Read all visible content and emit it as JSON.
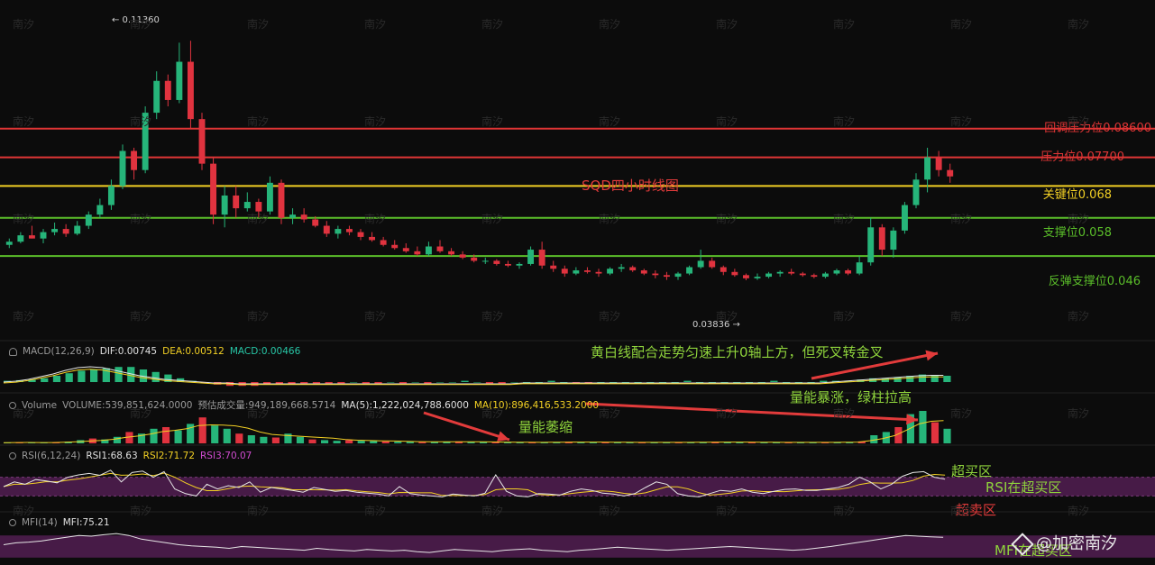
{
  "chart_data": {
    "type": "candlestick",
    "title": "SQD四小时线图",
    "price_range": [
      0.02,
      0.123
    ],
    "peak_label": "← 0.11360",
    "low_label": "0.03836 →",
    "levels": [
      {
        "label": "回调压力位0.08600",
        "value": 0.086,
        "color": "#e03535"
      },
      {
        "label": "压力位0.07700",
        "value": 0.077,
        "color": "#e03535"
      },
      {
        "label": "关键位0.068",
        "value": 0.068,
        "color": "#f2d024"
      },
      {
        "label": "支撑位0.058",
        "value": 0.058,
        "color": "#5bbf2a"
      },
      {
        "label": "反弹支撑位0.046",
        "value": 0.046,
        "color": "#5bbf2a"
      }
    ],
    "candles": [
      {
        "o": 0.0495,
        "h": 0.0515,
        "l": 0.0485,
        "c": 0.0505
      },
      {
        "o": 0.0505,
        "h": 0.0535,
        "l": 0.05,
        "c": 0.0525
      },
      {
        "o": 0.0525,
        "h": 0.0555,
        "l": 0.0515,
        "c": 0.0515
      },
      {
        "o": 0.0515,
        "h": 0.0545,
        "l": 0.05,
        "c": 0.0535
      },
      {
        "o": 0.0535,
        "h": 0.0565,
        "l": 0.0525,
        "c": 0.0545
      },
      {
        "o": 0.0545,
        "h": 0.056,
        "l": 0.052,
        "c": 0.053
      },
      {
        "o": 0.053,
        "h": 0.057,
        "l": 0.0525,
        "c": 0.0555
      },
      {
        "o": 0.0555,
        "h": 0.06,
        "l": 0.0545,
        "c": 0.059
      },
      {
        "o": 0.059,
        "h": 0.064,
        "l": 0.058,
        "c": 0.062
      },
      {
        "o": 0.062,
        "h": 0.07,
        "l": 0.0605,
        "c": 0.068
      },
      {
        "o": 0.068,
        "h": 0.081,
        "l": 0.067,
        "c": 0.079
      },
      {
        "o": 0.079,
        "h": 0.08,
        "l": 0.07,
        "c": 0.073
      },
      {
        "o": 0.073,
        "h": 0.093,
        "l": 0.072,
        "c": 0.091
      },
      {
        "o": 0.091,
        "h": 0.104,
        "l": 0.089,
        "c": 0.101
      },
      {
        "o": 0.101,
        "h": 0.103,
        "l": 0.093,
        "c": 0.095
      },
      {
        "o": 0.095,
        "h": 0.113,
        "l": 0.094,
        "c": 0.107
      },
      {
        "o": 0.107,
        "h": 0.1136,
        "l": 0.086,
        "c": 0.089
      },
      {
        "o": 0.089,
        "h": 0.091,
        "l": 0.073,
        "c": 0.075
      },
      {
        "o": 0.075,
        "h": 0.077,
        "l": 0.056,
        "c": 0.059
      },
      {
        "o": 0.059,
        "h": 0.068,
        "l": 0.055,
        "c": 0.065
      },
      {
        "o": 0.065,
        "h": 0.068,
        "l": 0.058,
        "c": 0.061
      },
      {
        "o": 0.061,
        "h": 0.066,
        "l": 0.06,
        "c": 0.063
      },
      {
        "o": 0.063,
        "h": 0.064,
        "l": 0.058,
        "c": 0.06
      },
      {
        "o": 0.06,
        "h": 0.071,
        "l": 0.059,
        "c": 0.069
      },
      {
        "o": 0.069,
        "h": 0.07,
        "l": 0.056,
        "c": 0.058
      },
      {
        "o": 0.058,
        "h": 0.061,
        "l": 0.056,
        "c": 0.059
      },
      {
        "o": 0.059,
        "h": 0.061,
        "l": 0.0565,
        "c": 0.0575
      },
      {
        "o": 0.0575,
        "h": 0.0585,
        "l": 0.055,
        "c": 0.0555
      },
      {
        "o": 0.0555,
        "h": 0.057,
        "l": 0.052,
        "c": 0.053
      },
      {
        "o": 0.053,
        "h": 0.0555,
        "l": 0.0515,
        "c": 0.0545
      },
      {
        "o": 0.0545,
        "h": 0.0555,
        "l": 0.0525,
        "c": 0.0535
      },
      {
        "o": 0.0535,
        "h": 0.0545,
        "l": 0.051,
        "c": 0.052
      },
      {
        "o": 0.052,
        "h": 0.0535,
        "l": 0.0505,
        "c": 0.051
      },
      {
        "o": 0.051,
        "h": 0.052,
        "l": 0.049,
        "c": 0.0495
      },
      {
        "o": 0.0495,
        "h": 0.051,
        "l": 0.048,
        "c": 0.0485
      },
      {
        "o": 0.0485,
        "h": 0.05,
        "l": 0.047,
        "c": 0.0475
      },
      {
        "o": 0.0475,
        "h": 0.049,
        "l": 0.046,
        "c": 0.0465
      },
      {
        "o": 0.0465,
        "h": 0.0505,
        "l": 0.046,
        "c": 0.049
      },
      {
        "o": 0.049,
        "h": 0.051,
        "l": 0.047,
        "c": 0.0475
      },
      {
        "o": 0.0475,
        "h": 0.0485,
        "l": 0.046,
        "c": 0.0465
      },
      {
        "o": 0.0465,
        "h": 0.0475,
        "l": 0.045,
        "c": 0.0455
      },
      {
        "o": 0.0455,
        "h": 0.0465,
        "l": 0.044,
        "c": 0.0445
      },
      {
        "o": 0.0445,
        "h": 0.0455,
        "l": 0.0435,
        "c": 0.0445
      },
      {
        "o": 0.0445,
        "h": 0.045,
        "l": 0.043,
        "c": 0.0435
      },
      {
        "o": 0.0435,
        "h": 0.0445,
        "l": 0.0425,
        "c": 0.043
      },
      {
        "o": 0.043,
        "h": 0.044,
        "l": 0.042,
        "c": 0.0435
      },
      {
        "o": 0.0435,
        "h": 0.049,
        "l": 0.043,
        "c": 0.048
      },
      {
        "o": 0.048,
        "h": 0.0505,
        "l": 0.042,
        "c": 0.043
      },
      {
        "o": 0.043,
        "h": 0.0445,
        "l": 0.041,
        "c": 0.042
      },
      {
        "o": 0.042,
        "h": 0.043,
        "l": 0.0395,
        "c": 0.0405
      },
      {
        "o": 0.0405,
        "h": 0.0425,
        "l": 0.04,
        "c": 0.0415
      },
      {
        "o": 0.0415,
        "h": 0.0425,
        "l": 0.0405,
        "c": 0.041
      },
      {
        "o": 0.041,
        "h": 0.042,
        "l": 0.0395,
        "c": 0.0405
      },
      {
        "o": 0.0405,
        "h": 0.0425,
        "l": 0.04,
        "c": 0.042
      },
      {
        "o": 0.042,
        "h": 0.0435,
        "l": 0.041,
        "c": 0.0425
      },
      {
        "o": 0.0425,
        "h": 0.043,
        "l": 0.041,
        "c": 0.0415
      },
      {
        "o": 0.0415,
        "h": 0.042,
        "l": 0.04,
        "c": 0.0405
      },
      {
        "o": 0.0405,
        "h": 0.0415,
        "l": 0.039,
        "c": 0.04
      },
      {
        "o": 0.04,
        "h": 0.041,
        "l": 0.0385,
        "c": 0.0395
      },
      {
        "o": 0.0395,
        "h": 0.041,
        "l": 0.0385,
        "c": 0.0405
      },
      {
        "o": 0.0405,
        "h": 0.043,
        "l": 0.04,
        "c": 0.0425
      },
      {
        "o": 0.0425,
        "h": 0.048,
        "l": 0.042,
        "c": 0.0445
      },
      {
        "o": 0.0445,
        "h": 0.0455,
        "l": 0.042,
        "c": 0.0425
      },
      {
        "o": 0.0425,
        "h": 0.043,
        "l": 0.04,
        "c": 0.041
      },
      {
        "o": 0.041,
        "h": 0.042,
        "l": 0.0395,
        "c": 0.04
      },
      {
        "o": 0.04,
        "h": 0.0405,
        "l": 0.0384,
        "c": 0.039
      },
      {
        "o": 0.039,
        "h": 0.0405,
        "l": 0.0385,
        "c": 0.0395
      },
      {
        "o": 0.0395,
        "h": 0.041,
        "l": 0.039,
        "c": 0.0405
      },
      {
        "o": 0.0405,
        "h": 0.0415,
        "l": 0.0395,
        "c": 0.041
      },
      {
        "o": 0.041,
        "h": 0.042,
        "l": 0.04,
        "c": 0.0405
      },
      {
        "o": 0.0405,
        "h": 0.041,
        "l": 0.0395,
        "c": 0.04
      },
      {
        "o": 0.04,
        "h": 0.0405,
        "l": 0.039,
        "c": 0.0395
      },
      {
        "o": 0.0395,
        "h": 0.041,
        "l": 0.039,
        "c": 0.0405
      },
      {
        "o": 0.0405,
        "h": 0.042,
        "l": 0.04,
        "c": 0.0415
      },
      {
        "o": 0.0415,
        "h": 0.042,
        "l": 0.04,
        "c": 0.0405
      },
      {
        "o": 0.0405,
        "h": 0.046,
        "l": 0.04,
        "c": 0.044
      },
      {
        "o": 0.044,
        "h": 0.058,
        "l": 0.043,
        "c": 0.055
      },
      {
        "o": 0.055,
        "h": 0.056,
        "l": 0.046,
        "c": 0.048
      },
      {
        "o": 0.048,
        "h": 0.055,
        "l": 0.0455,
        "c": 0.054
      },
      {
        "o": 0.054,
        "h": 0.063,
        "l": 0.053,
        "c": 0.062
      },
      {
        "o": 0.062,
        "h": 0.072,
        "l": 0.061,
        "c": 0.07
      },
      {
        "o": 0.07,
        "h": 0.08,
        "l": 0.066,
        "c": 0.077
      },
      {
        "o": 0.077,
        "h": 0.079,
        "l": 0.071,
        "c": 0.073
      },
      {
        "o": 0.073,
        "h": 0.075,
        "l": 0.069,
        "c": 0.071
      }
    ],
    "macd": {
      "label": "MACD(12,26,9)",
      "dif": "DIF:0.00745",
      "dea": "DEA:0.00512",
      "macd": "MACD:0.00466",
      "hist": [
        0.001,
        0.0015,
        0.002,
        0.003,
        0.005,
        0.007,
        0.009,
        0.01,
        0.011,
        0.012,
        0.012,
        0.01,
        0.008,
        0.006,
        0.003,
        0.001,
        -0.001,
        -0.002,
        -0.003,
        -0.003,
        -0.003,
        -0.002,
        -0.002,
        -0.002,
        -0.001,
        -0.001,
        -0.001,
        -0.001,
        0,
        -0.001,
        -0.001,
        0,
        -0.001,
        0,
        -0.001,
        0,
        0,
        0.001,
        0,
        -0.001,
        -0.001,
        0,
        0,
        0,
        0.001,
        0,
        -0.001,
        -0.001,
        0,
        0,
        0,
        0,
        0,
        0,
        0,
        0.001,
        0,
        0,
        0,
        0,
        0,
        0,
        0.001,
        0,
        0,
        0,
        0.001,
        0.001,
        0.001,
        0.002,
        0.003,
        0.003,
        0.004,
        0.005,
        0.006,
        0.005,
        0.005
      ],
      "dif_line": [
        0.0,
        0.001,
        0.003,
        0.006,
        0.009,
        0.013,
        0.016,
        0.017,
        0.016,
        0.013,
        0.01,
        0.007,
        0.005,
        0.003,
        0.002,
        0.001,
        0.0,
        -0.001,
        -0.001,
        -0.002,
        -0.002,
        -0.002,
        -0.002,
        -0.002,
        -0.002,
        -0.002,
        -0.002,
        -0.002,
        -0.002,
        -0.002,
        -0.002,
        -0.002,
        -0.002,
        -0.002,
        -0.002,
        -0.002,
        -0.002,
        -0.002,
        -0.002,
        -0.002,
        -0.002,
        -0.002,
        -0.001,
        -0.001,
        -0.001,
        -0.001,
        -0.001,
        -0.001,
        -0.001,
        -0.001,
        -0.001,
        -0.001,
        -0.001,
        -0.001,
        -0.001,
        -0.001,
        -0.001,
        -0.001,
        -0.001,
        -0.001,
        -0.001,
        -0.001,
        -0.001,
        -0.001,
        -0.001,
        -0.001,
        -0.001,
        0.0,
        0.001,
        0.002,
        0.003,
        0.004,
        0.005,
        0.006,
        0.007,
        0.0075,
        0.0075
      ]
    },
    "volume": {
      "label": "Volume",
      "volume": "VOLUME:539,851,624.0000",
      "est": "预估成交量:949,189,668.5714",
      "ma5": "MA(5):1,222,024,788.6000",
      "ma10": "MA(10):896,416,533.2000",
      "bars": [
        0.02,
        0.03,
        0.03,
        0.02,
        0.03,
        0.05,
        0.1,
        0.15,
        0.12,
        0.2,
        0.35,
        0.3,
        0.45,
        0.5,
        0.4,
        0.6,
        0.8,
        0.55,
        0.45,
        0.3,
        0.25,
        0.2,
        0.18,
        0.3,
        0.2,
        0.12,
        0.1,
        0.08,
        0.1,
        0.08,
        0.07,
        0.06,
        0.05,
        0.05,
        0.04,
        0.04,
        0.05,
        0.06,
        0.04,
        0.04,
        0.03,
        0.03,
        0.03,
        0.03,
        0.03,
        0.04,
        0.05,
        0.04,
        0.03,
        0.03,
        0.03,
        0.03,
        0.03,
        0.03,
        0.03,
        0.03,
        0.03,
        0.04,
        0.05,
        0.04,
        0.03,
        0.03,
        0.03,
        0.03,
        0.03,
        0.03,
        0.03,
        0.03,
        0.03,
        0.04,
        0.06,
        0.25,
        0.35,
        0.5,
        0.9,
        1.0,
        0.65,
        0.45
      ]
    },
    "rsi": {
      "label": "RSI(6,12,24)",
      "rsi1": "RSI1:68.63",
      "rsi2": "RSI2:71.72",
      "rsi3": "RSI3:70.07",
      "overbought": 70,
      "oversold": 30,
      "rsi1_line": [
        50,
        60,
        55,
        65,
        62,
        58,
        70,
        75,
        78,
        74,
        85,
        60,
        80,
        83,
        70,
        82,
        45,
        35,
        30,
        55,
        45,
        52,
        48,
        60,
        38,
        48,
        45,
        42,
        38,
        48,
        44,
        40,
        42,
        38,
        36,
        34,
        30,
        50,
        35,
        32,
        30,
        28,
        34,
        32,
        30,
        36,
        75,
        40,
        30,
        28,
        35,
        34,
        32,
        40,
        45,
        42,
        36,
        34,
        30,
        35,
        48,
        60,
        55,
        35,
        30,
        28,
        35,
        42,
        40,
        45,
        38,
        35,
        40,
        44,
        45,
        42,
        42,
        45,
        48,
        55,
        70,
        60,
        45,
        55,
        72,
        80,
        82,
        70,
        66
      ]
    },
    "mfi": {
      "label": "MFI(14)",
      "mfi": "MFI:75.21",
      "line": [
        55,
        60,
        62,
        65,
        70,
        75,
        80,
        78,
        82,
        85,
        80,
        70,
        65,
        60,
        55,
        52,
        50,
        48,
        45,
        50,
        48,
        46,
        44,
        42,
        40,
        45,
        42,
        40,
        38,
        42,
        40,
        38,
        40,
        36,
        34,
        38,
        42,
        40,
        38,
        36,
        40,
        42,
        44,
        40,
        38,
        36,
        40,
        42,
        45,
        48,
        46,
        44,
        42,
        40,
        42,
        44,
        46,
        48,
        50,
        48,
        46,
        44,
        42,
        40,
        42,
        46,
        50,
        55,
        60,
        65,
        70,
        75,
        80,
        78,
        76,
        75
      ]
    },
    "notes": {
      "macd": "黄白线配合走势匀速上升0轴上方，但死叉转金叉",
      "volume_shrink": "量能萎缩",
      "volume_surge": "量能暴涨，绿柱拉高",
      "overbought_zone": "超买区",
      "rsi_state": "RSI在超买区",
      "oversold_zone": "超卖区",
      "mfi_state": "MFI在超买区"
    },
    "watermark": "@加密南汐",
    "tile_mark": "南汐"
  }
}
